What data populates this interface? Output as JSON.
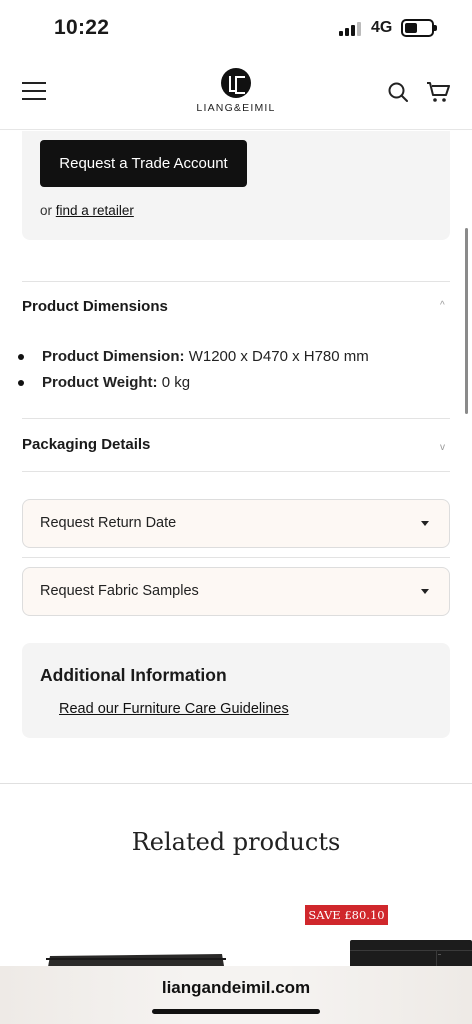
{
  "status_bar": {
    "time": "10:22",
    "network": "4G",
    "icons": [
      "signal-icon",
      "battery-icon"
    ]
  },
  "header": {
    "logo_text": "LIANG&EIMIL",
    "icons": [
      "menu-icon",
      "logo-mark-icon",
      "search-icon",
      "cart-icon"
    ]
  },
  "trade": {
    "button_label": "Request a Trade Account",
    "retailer_prefix": "or",
    "retailer_link": "find a retailer"
  },
  "dimensions": {
    "title": "Product Dimensions",
    "chevron": "^",
    "items": [
      {
        "label": "Product Dimension:",
        "value": "W1200 x D470 x H780 mm"
      },
      {
        "label": "Product Weight:",
        "value": "0 kg"
      }
    ]
  },
  "packaging": {
    "title": "Packaging Details",
    "chevron": "v"
  },
  "selects": {
    "return_date": "Request Return Date",
    "fabric_samples": "Request Fabric Samples"
  },
  "additional_info": {
    "title": "Additional Information",
    "link": "Read our Furniture Care Guidelines"
  },
  "related": {
    "title": "Related products",
    "badge": "SAVE £80.10"
  },
  "browser": {
    "url": "liangandeimil.com"
  },
  "colors": {
    "badge_red": "#d0272c",
    "button_black": "#111111",
    "panel_grey": "#f4f4f4",
    "select_bg": "#fdf8f4"
  }
}
